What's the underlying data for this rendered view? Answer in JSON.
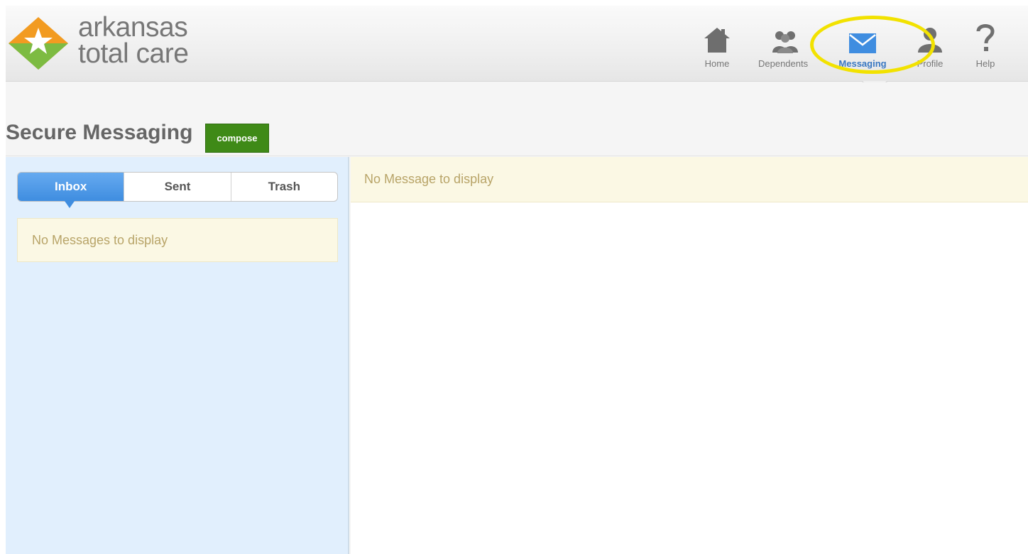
{
  "brand": {
    "line1": "arkansas",
    "line2": "total care",
    "colors": {
      "orange": "#f29b21",
      "green": "#7dbb42",
      "text": "#777777"
    }
  },
  "nav": {
    "items": [
      {
        "label": "Home",
        "icon": "home-icon"
      },
      {
        "label": "Dependents",
        "icon": "dependents-icon"
      },
      {
        "label": "Messaging",
        "icon": "envelope-icon",
        "active": true
      },
      {
        "label": "Profile",
        "icon": "profile-icon"
      },
      {
        "label": "Help",
        "icon": "help-icon"
      }
    ],
    "active_color": "#3a78c2",
    "highlight_color": "#f2e200"
  },
  "page": {
    "title": "Secure Messaging",
    "compose_label": "compose",
    "compose_color": "#3f8a17"
  },
  "mailbox": {
    "tabs": [
      {
        "label": "Inbox",
        "active": true
      },
      {
        "label": "Sent"
      },
      {
        "label": "Trash"
      }
    ],
    "empty_list_text": "No Messages to display",
    "empty_detail_text": "No Message to display",
    "pane_color": "#e1effd",
    "notice_color": "#fbf8e4"
  }
}
